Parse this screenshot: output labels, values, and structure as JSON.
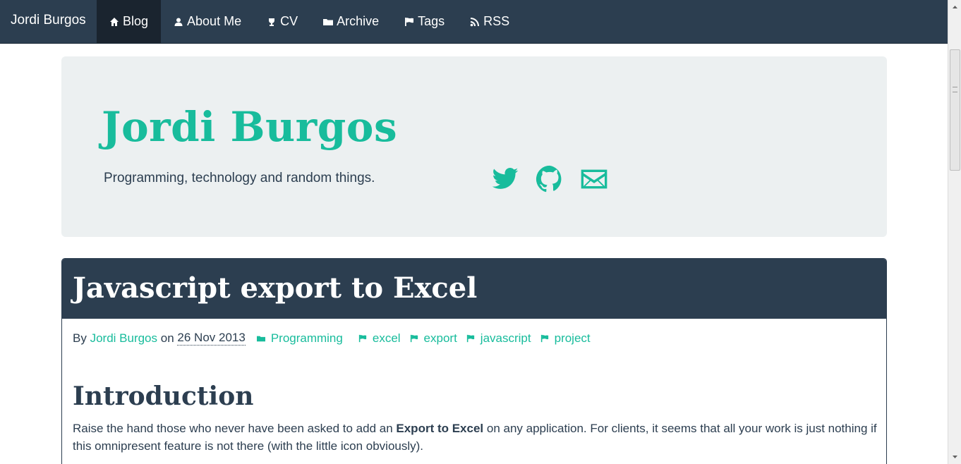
{
  "navbar": {
    "brand": "Jordi Burgos",
    "items": [
      {
        "label": "Blog",
        "icon": "home-icon",
        "active": true
      },
      {
        "label": "About Me",
        "icon": "user-icon",
        "active": false
      },
      {
        "label": "CV",
        "icon": "trophy-icon",
        "active": false
      },
      {
        "label": "Archive",
        "icon": "folder-icon",
        "active": false
      },
      {
        "label": "Tags",
        "icon": "flag-icon",
        "active": false
      },
      {
        "label": "RSS",
        "icon": "rss-icon",
        "active": false
      }
    ]
  },
  "header": {
    "title": "Jordi Burgos",
    "tagline": "Programming, technology and random things.",
    "social": [
      "twitter-icon",
      "github-icon",
      "mail-icon"
    ]
  },
  "post": {
    "title": "Javascript export to Excel",
    "meta": {
      "by": "By",
      "author": "Jordi Burgos",
      "on": "on",
      "date": "26 Nov 2013",
      "category": "Programming",
      "tags": [
        "excel",
        "export",
        "javascript",
        "project"
      ]
    },
    "section_heading": "Introduction",
    "paragraph": {
      "before": "Raise the hand those who never have been asked to add an ",
      "bold": "Export to Excel",
      "after": " on any application. For clients, it seems that all your work is just nothing if this omnipresent feature is not there (with the little icon obviously)."
    }
  },
  "colors": {
    "navbar": "#2c3e50",
    "accent": "#18bc9c",
    "jumbotron": "#ecf0f1",
    "text": "#2c3e50"
  }
}
